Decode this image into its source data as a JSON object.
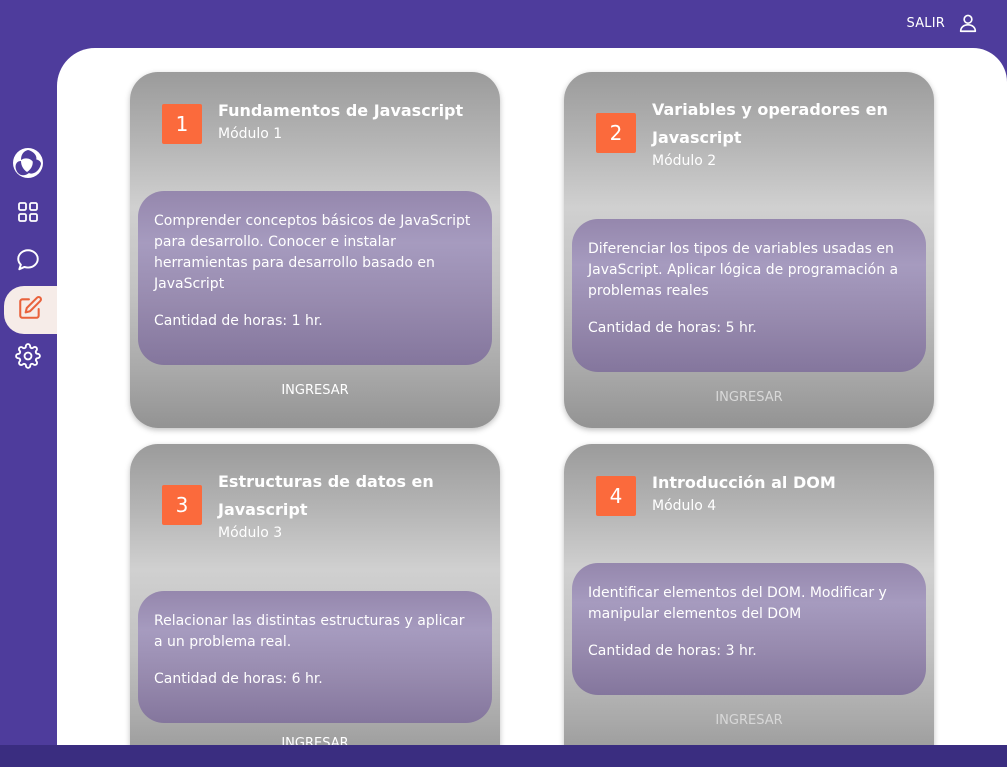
{
  "topbar": {
    "logout_label": "SALIR",
    "logout_icon": "user-icon"
  },
  "sidebar": {
    "items": [
      {
        "icon": "logo-icon"
      },
      {
        "icon": "grid-icon"
      },
      {
        "icon": "chat-icon"
      },
      {
        "icon": "edit-icon",
        "active": true
      },
      {
        "icon": "gear-icon"
      }
    ]
  },
  "colors": {
    "primary": "#4e3c9c",
    "badge": "#fb6a3c",
    "active_bg": "#f6ece8",
    "accent_icon": "#e9623c"
  },
  "modules": [
    {
      "number": "1",
      "title": "Fundamentos de Javascript",
      "subtitle": "Módulo 1",
      "description": "Comprender conceptos básicos de JavaScript para desarrollo. Conocer e instalar herramientas para desarrollo basado en JavaScript",
      "hours": "Cantidad de horas: 1 hr.",
      "button": "INGRESAR"
    },
    {
      "number": "2",
      "title": "Variables y operadores en Javascript",
      "subtitle": "Módulo 2",
      "description": "Diferenciar los tipos de variables usadas en JavaScript. Aplicar lógica de programación a problemas reales",
      "hours": "Cantidad de horas: 5 hr.",
      "button": "INGRESAR"
    },
    {
      "number": "3",
      "title": "Estructuras de datos en Javascript",
      "subtitle": "Módulo 3",
      "description": "Relacionar las distintas estructuras y aplicar a un problema real.",
      "hours": "Cantidad de horas: 6 hr.",
      "button": "INGRESAR"
    },
    {
      "number": "4",
      "title": "Introducción al DOM",
      "subtitle": "Módulo 4",
      "description": "Identificar elementos del DOM. Modificar y manipular elementos del DOM",
      "hours": "Cantidad de horas: 3 hr.",
      "button": "INGRESAR"
    }
  ]
}
